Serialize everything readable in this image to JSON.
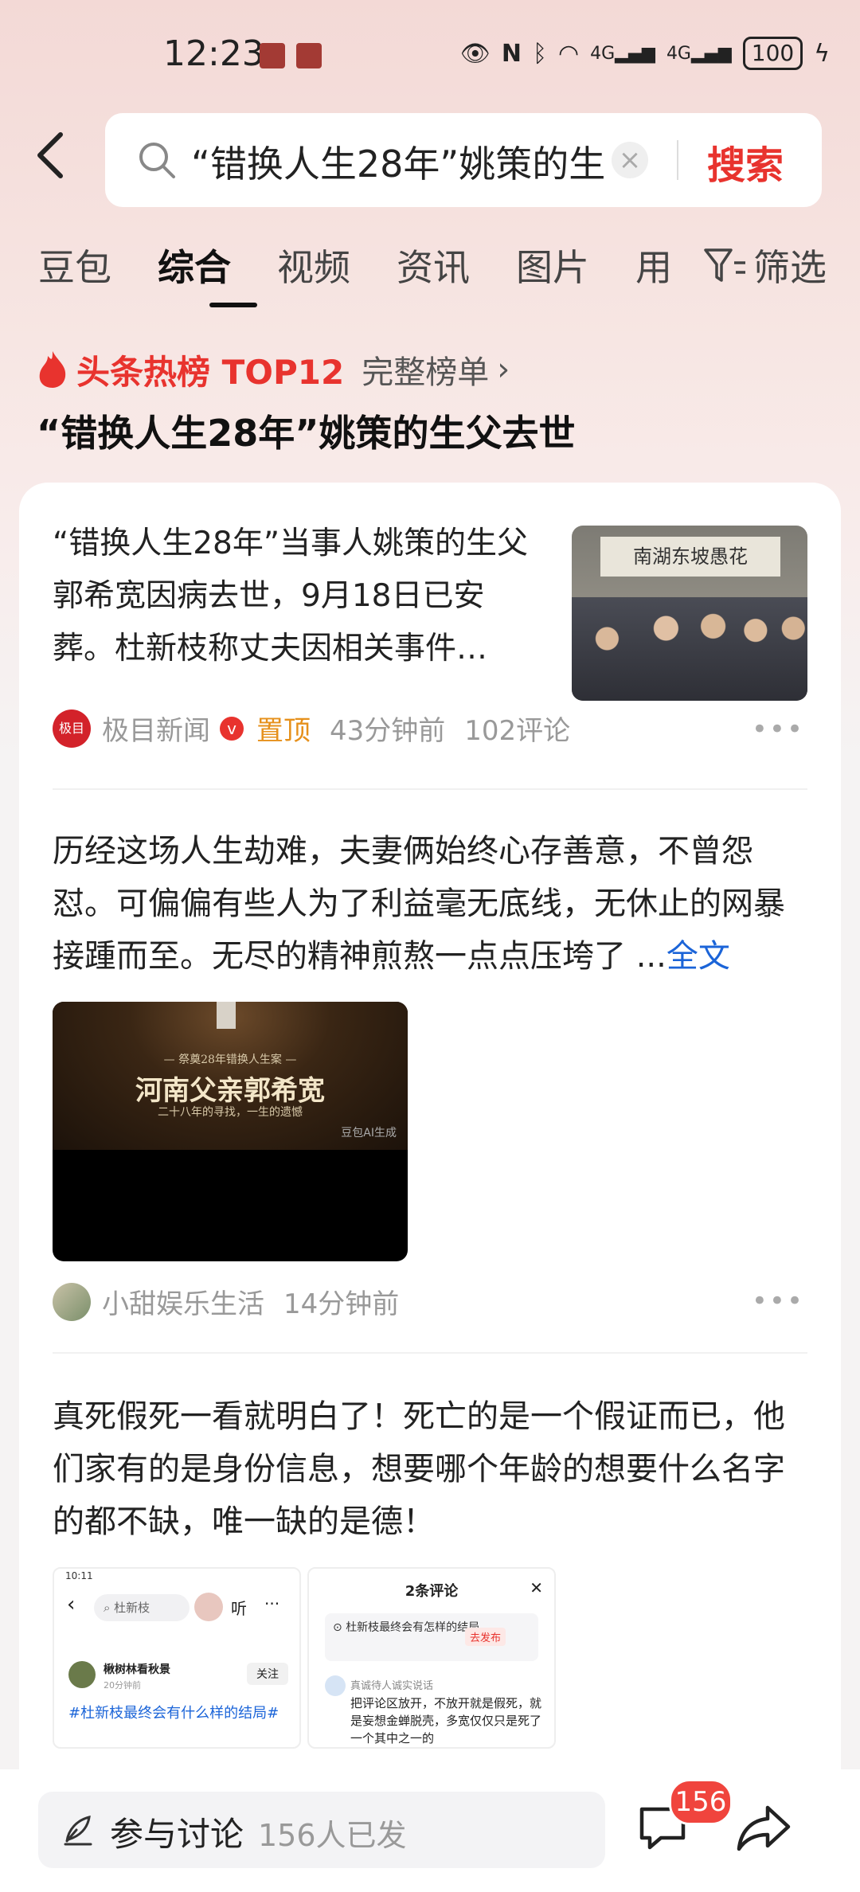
{
  "status_bar": {
    "time": "12:23",
    "network1": "4G",
    "network2": "4G",
    "battery": "100"
  },
  "search": {
    "query": "“错换人生28年”姚策的生",
    "button": "搜索"
  },
  "tabs": [
    "豆包",
    "综合",
    "视频",
    "资讯",
    "图片",
    "用"
  ],
  "filter_label": "筛选",
  "hot": {
    "title": "头条热榜 TOP12",
    "link": "完整榜单",
    "headline": "“错换人生28年”姚策的生父去世"
  },
  "news": {
    "text": "“错换人生28年”当事人姚策的生父郭希宽因病去世，9月18日已安葬。杜新枝称丈夫因相关事件…",
    "thumb_banner": "南湖东坡愚花",
    "source_logo": "极目",
    "source": "极目新闻",
    "pinned": "置顶",
    "time": "43分钟前",
    "comments": "102评论"
  },
  "post1": {
    "text": "历经这场人生劫难，夫妻俩始终心存善意，不曾怨怼。可偏偏有些人为了利益毫无底线，无休止的网暴接踵而至。无尽的精神煎熬一点点压垮了 ...",
    "fulltext": "全文",
    "video_sub1": "— 祭奠28年错换人生案 —",
    "video_title": "河南父亲郭希宽",
    "video_sub2": "二十八年的寻找，一生的遗憾",
    "ai_label": "豆包AI生成",
    "author": "小甜娱乐生活",
    "time": "14分钟前"
  },
  "post2": {
    "text": "真死假死一看就明白了！死亡的是一个假证而已，他们家有的是身份信息，想要哪个年龄的想要什么名字的都不缺，唯一缺的是德！",
    "shot1": {
      "status_time": "10:11",
      "search": "杜新枝",
      "listen": "听",
      "user": "楸树林看秋景",
      "user_time": "20分钟前",
      "follow": "关注",
      "tag": "#杜新枝最终会有什么样的结局#"
    },
    "shot2": {
      "title": "2条评论",
      "topic": "杜新枝最终会有怎样的结局",
      "publish": "去发布",
      "commenter": "真诚待人诚实说话",
      "comment": "把评论区放开，不放开就是假死，就是妄想金蝉脱壳，多宽仅仅只是死了一个其中之一的"
    }
  },
  "bottom": {
    "discuss": "参与讨论",
    "discuss_count": "156人已发",
    "comment_badge": "156"
  },
  "colors": {
    "accent_red": "#e8332e",
    "link_blue": "#1b64d8",
    "pinned_orange": "#e6901b"
  }
}
